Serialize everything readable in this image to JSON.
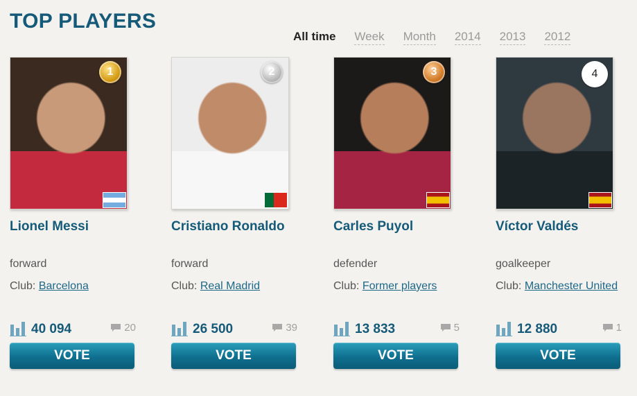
{
  "page": {
    "title": "TOP PLAYERS"
  },
  "filters": [
    {
      "label": "All time",
      "active": true
    },
    {
      "label": "Week",
      "active": false
    },
    {
      "label": "Month",
      "active": false
    },
    {
      "label": "2014",
      "active": false
    },
    {
      "label": "2013",
      "active": false
    },
    {
      "label": "2012",
      "active": false
    }
  ],
  "players": [
    {
      "rank": "1",
      "rank_style": "gold",
      "name": "Lionel Messi",
      "position": "forward",
      "club_prefix": "Club:",
      "club": "Barcelona",
      "flag": "argentina",
      "votes": "40 094",
      "comments": "20",
      "vote_label": "VOTE",
      "photo_colors": [
        "#3a2a1f",
        "#c99a7a",
        "#c42a3d"
      ]
    },
    {
      "rank": "2",
      "rank_style": "silver",
      "name": "Cristiano Ronaldo",
      "position": "forward",
      "club_prefix": "Club:",
      "club": "Real Madrid",
      "flag": "portugal",
      "votes": "26 500",
      "comments": "39",
      "vote_label": "VOTE",
      "photo_colors": [
        "#ededed",
        "#c08b69",
        "#f7f7f7"
      ]
    },
    {
      "rank": "3",
      "rank_style": "bronze",
      "name": "Carles Puyol",
      "position": "defender",
      "club_prefix": "Club:",
      "club": "Former players",
      "flag": "spain",
      "votes": "13 833",
      "comments": "5",
      "vote_label": "VOTE",
      "photo_colors": [
        "#1c1a18",
        "#b77e5c",
        "#a52444"
      ]
    },
    {
      "rank": "4",
      "rank_style": "plain",
      "name": "Víctor Valdés",
      "position": "goalkeeper",
      "club_prefix": "Club:",
      "club": "Manchester United",
      "flag": "spain",
      "votes": "12 880",
      "comments": "1",
      "vote_label": "VOTE",
      "photo_colors": [
        "#2f3a40",
        "#9a7560",
        "#1c2326"
      ]
    }
  ]
}
